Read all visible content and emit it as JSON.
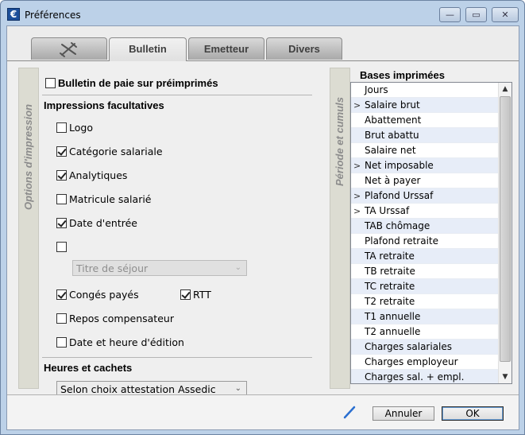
{
  "window": {
    "title": "Préférences",
    "app_icon_glyph": "€",
    "controls": {
      "minimize": "—",
      "maximize": "▭",
      "close": "✕"
    }
  },
  "tabs": [
    {
      "label": "",
      "icon": "tools-icon",
      "active": false
    },
    {
      "label": "Bulletin",
      "active": true
    },
    {
      "label": "Emetteur",
      "active": false
    },
    {
      "label": "Divers",
      "active": false
    }
  ],
  "left_section": {
    "vertical_label": "Options d'impression",
    "bulletin_preimprimes": {
      "label": "Bulletin de paie sur préimprimés",
      "checked": false
    },
    "impressions_title": "Impressions facultatives",
    "options": {
      "logo": {
        "label": "Logo",
        "checked": false
      },
      "categorie": {
        "label": "Catégorie salariale",
        "checked": true
      },
      "analytiques": {
        "label": "Analytiques",
        "checked": true
      },
      "matricule": {
        "label": "Matricule salarié",
        "checked": false
      },
      "date_entree": {
        "label": "Date d'entrée",
        "checked": true
      },
      "titre_sejour": {
        "label": "Titre de séjour",
        "checked": false
      },
      "conges": {
        "label": "Congés payés",
        "checked": true
      },
      "rtt": {
        "label": "RTT",
        "checked": true
      },
      "repos": {
        "label": "Repos compensateur",
        "checked": false
      },
      "date_edition": {
        "label": "Date et heure d'édition",
        "checked": false
      }
    },
    "heures_title": "Heures et cachets",
    "heures_select": "Selon choix attestation Assedic"
  },
  "right_section": {
    "vertical_label": "Période et cumuls",
    "list_title": "Bases imprimées",
    "items": [
      {
        "label": "Jours",
        "marker": "",
        "alt": false
      },
      {
        "label": "Salaire brut",
        "marker": ">",
        "alt": true
      },
      {
        "label": "Abattement",
        "marker": "",
        "alt": false
      },
      {
        "label": "Brut abattu",
        "marker": "",
        "alt": true
      },
      {
        "label": "Salaire net",
        "marker": "",
        "alt": false
      },
      {
        "label": "Net imposable",
        "marker": ">",
        "alt": true
      },
      {
        "label": "Net à payer",
        "marker": "",
        "alt": false
      },
      {
        "label": "Plafond Urssaf",
        "marker": ">",
        "alt": true
      },
      {
        "label": "TA Urssaf",
        "marker": ">",
        "alt": false
      },
      {
        "label": "TAB chômage",
        "marker": "",
        "alt": true
      },
      {
        "label": "Plafond retraite",
        "marker": "",
        "alt": false
      },
      {
        "label": "TA retraite",
        "marker": "",
        "alt": true
      },
      {
        "label": "TB retraite",
        "marker": "",
        "alt": false
      },
      {
        "label": "TC retraite",
        "marker": "",
        "alt": true
      },
      {
        "label": "T2 retraite",
        "marker": "",
        "alt": false
      },
      {
        "label": "T1 annuelle",
        "marker": "",
        "alt": true
      },
      {
        "label": "T2 annuelle",
        "marker": "",
        "alt": false
      },
      {
        "label": "Charges salariales",
        "marker": "",
        "alt": true
      },
      {
        "label": "Charges employeur",
        "marker": "",
        "alt": false
      },
      {
        "label": "Charges sal. + empl.",
        "marker": "",
        "alt": true
      }
    ]
  },
  "footer": {
    "cancel_label": "Annuler",
    "ok_label": "OK"
  }
}
